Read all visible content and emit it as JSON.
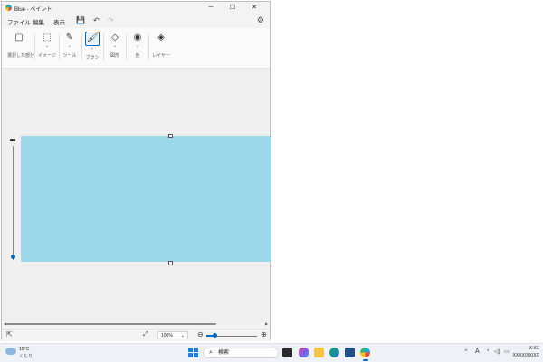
{
  "window": {
    "title": "Blue - ペイント",
    "controls": {
      "minimize": "─",
      "maximize": "☐",
      "close": "✕"
    }
  },
  "menubar": {
    "items": [
      "ファイル",
      "編集",
      "表示"
    ]
  },
  "quick_access": {
    "save_icon": "💾",
    "undo_icon": "↶",
    "redo_icon": "↷",
    "settings_icon": "⚙"
  },
  "ribbon": {
    "groups": [
      {
        "label": "選択した部分",
        "icon": "▢"
      },
      {
        "label": "イメージ",
        "icon": "⬚"
      },
      {
        "label": "ツール",
        "icon": "✎"
      },
      {
        "label": "ブラシ",
        "icon": "🖌"
      },
      {
        "label": "図形",
        "icon": "◇"
      },
      {
        "label": "色",
        "icon": "◉"
      },
      {
        "label": "レイヤー",
        "icon": "◈"
      }
    ]
  },
  "canvas": {
    "fill_color": "#9dd7ea"
  },
  "status_bar": {
    "zoom": "100%",
    "zoom_level_fraction": 0.12
  },
  "taskbar": {
    "weather": {
      "temp": "15°C",
      "condition": "くもり"
    },
    "search_placeholder": "検索",
    "ime": "A",
    "clock": {
      "time": "X:XX",
      "date": "XXXX/XX/XX"
    }
  }
}
